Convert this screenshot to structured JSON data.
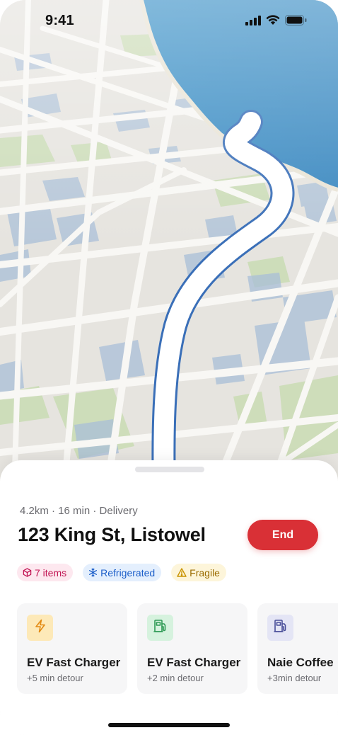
{
  "status_bar": {
    "time": "9:41",
    "icons": [
      "signal-icon",
      "wifi-icon",
      "battery-icon"
    ]
  },
  "map": {
    "colors": {
      "land": "#e8e6e1",
      "road": "#f7f6f3",
      "water": "#3f94c9",
      "park": "#c9dcb4",
      "building": "#a9bfd8",
      "route": "#3a6fb8"
    }
  },
  "trip": {
    "meta": "4.2km · 16 min · Delivery",
    "address": "123 King St, Listowel",
    "end_label": "End"
  },
  "tags": [
    {
      "label": "7 items",
      "icon": "package-icon",
      "color": "#c21654"
    },
    {
      "label": "Refrigerated",
      "icon": "snowflake-icon",
      "color": "#1d5fc9"
    },
    {
      "label": "Fragile",
      "icon": "warning-icon",
      "color": "#9a6b00"
    }
  ],
  "stops": [
    {
      "title": "EV Fast Charger",
      "detour": "+5 min detour",
      "icon": "lightning-icon",
      "icon_bg": "#fde9b8",
      "icon_color": "#e38a12"
    },
    {
      "title": "EV Fast Charger",
      "detour": "+2 min detour",
      "icon": "fuel-pump-icon",
      "icon_bg": "#d6f2de",
      "icon_color": "#2e9a55"
    },
    {
      "title": "Naie Coffee",
      "detour": "+3min detour",
      "icon": "fuel-pump-icon",
      "icon_bg": "#e4e5f5",
      "icon_color": "#4a4f9a"
    }
  ]
}
